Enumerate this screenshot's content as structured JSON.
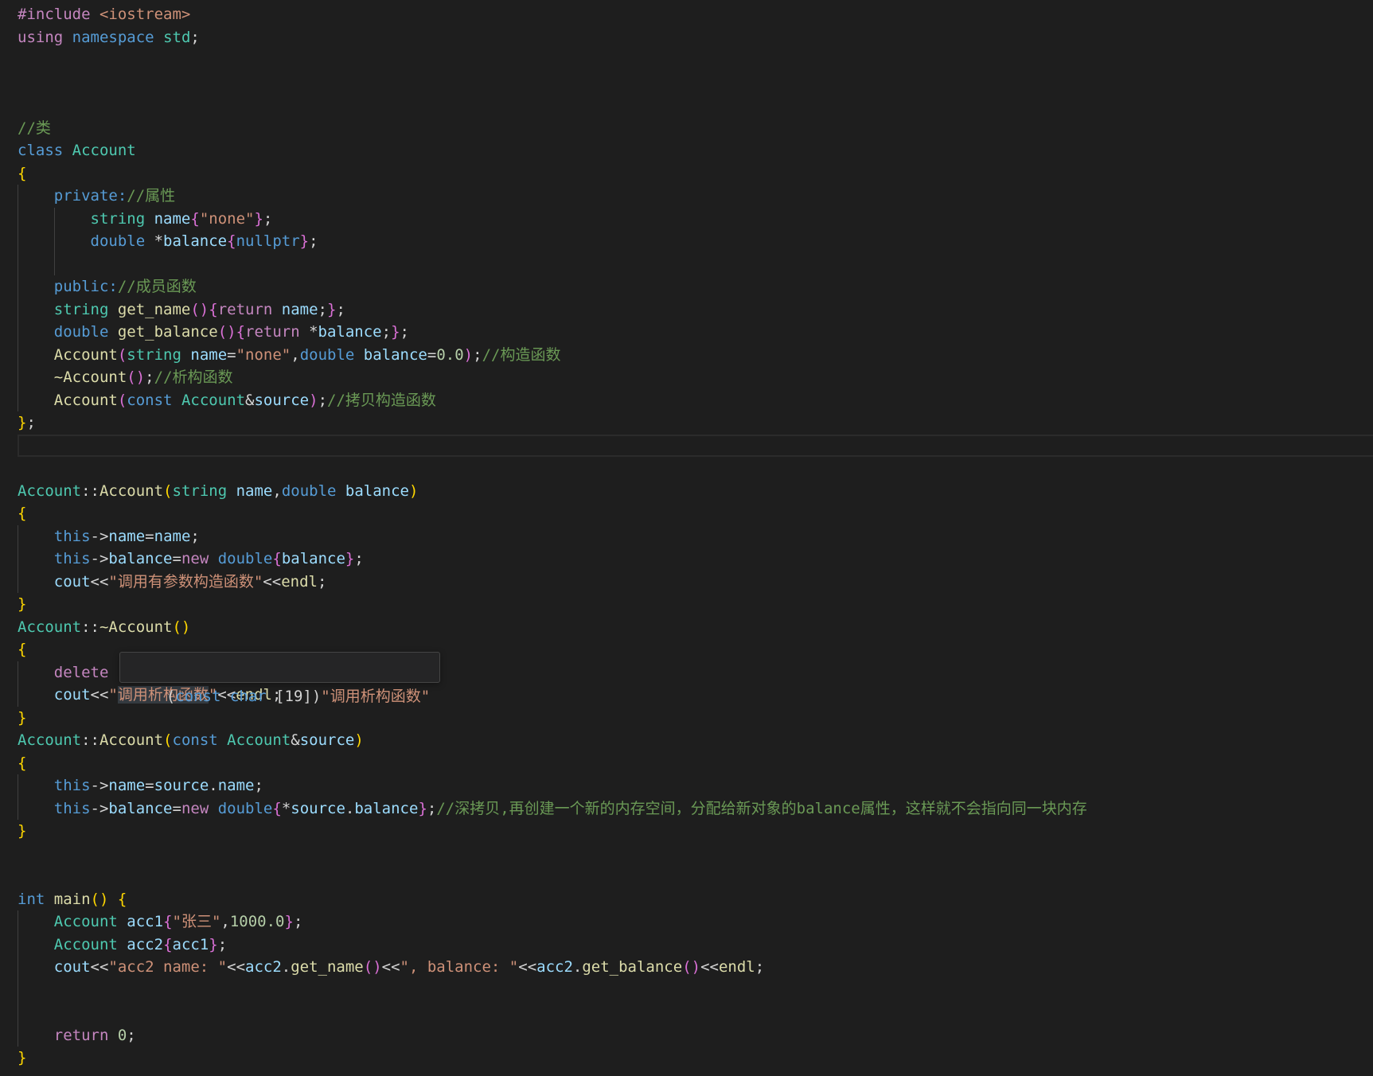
{
  "editor": {
    "lines": [
      [
        [
          "#include",
          "#c586c0"
        ],
        [
          " ",
          "#d4d4d4"
        ],
        [
          "<iostream>",
          "#ce9178"
        ]
      ],
      [
        [
          "using",
          "#c586c0"
        ],
        [
          " ",
          "#d4d4d4"
        ],
        [
          "namespace",
          "#569cd6"
        ],
        [
          " ",
          "#d4d4d4"
        ],
        [
          "std",
          "#4ec9b0"
        ],
        [
          ";",
          "#d4d4d4"
        ]
      ],
      [],
      [],
      [],
      [
        [
          "//类",
          "#6a9955"
        ]
      ],
      [
        [
          "class",
          "#569cd6"
        ],
        [
          " ",
          "#d4d4d4"
        ],
        [
          "Account",
          "#4ec9b0"
        ]
      ],
      [
        [
          "{",
          "#ffd700"
        ]
      ],
      [
        [
          "    private:",
          "#569cd6"
        ],
        [
          "//属性",
          "#6a9955"
        ]
      ],
      [
        [
          "        string",
          "#4ec9b0"
        ],
        [
          " ",
          "#d4d4d4"
        ],
        [
          "name",
          "#9cdcfe"
        ],
        [
          "{",
          "#da70d6"
        ],
        [
          "\"none\"",
          "#ce9178"
        ],
        [
          "}",
          "#da70d6"
        ],
        [
          ";",
          "#d4d4d4"
        ]
      ],
      [
        [
          "        double",
          "#569cd6"
        ],
        [
          " *",
          "#d4d4d4"
        ],
        [
          "balance",
          "#9cdcfe"
        ],
        [
          "{",
          "#da70d6"
        ],
        [
          "nullptr",
          "#569cd6"
        ],
        [
          "}",
          "#da70d6"
        ],
        [
          ";",
          "#d4d4d4"
        ]
      ],
      [],
      [
        [
          "    public:",
          "#569cd6"
        ],
        [
          "//成员函数",
          "#6a9955"
        ]
      ],
      [
        [
          "    string",
          "#4ec9b0"
        ],
        [
          " ",
          "#d4d4d4"
        ],
        [
          "get_name",
          "#dcdcaa"
        ],
        [
          "(){",
          "#da70d6"
        ],
        [
          "return",
          "#c586c0"
        ],
        [
          " ",
          "#d4d4d4"
        ],
        [
          "name",
          "#9cdcfe"
        ],
        [
          ";",
          "#d4d4d4"
        ],
        [
          "}",
          "#da70d6"
        ],
        [
          ";",
          "#d4d4d4"
        ]
      ],
      [
        [
          "    double",
          "#569cd6"
        ],
        [
          " ",
          "#d4d4d4"
        ],
        [
          "get_balance",
          "#dcdcaa"
        ],
        [
          "(){",
          "#da70d6"
        ],
        [
          "return",
          "#c586c0"
        ],
        [
          " *",
          "#d4d4d4"
        ],
        [
          "balance",
          "#9cdcfe"
        ],
        [
          ";",
          "#d4d4d4"
        ],
        [
          "}",
          "#da70d6"
        ],
        [
          ";",
          "#d4d4d4"
        ]
      ],
      [
        [
          "    Account",
          "#dcdcaa"
        ],
        [
          "(",
          "#da70d6"
        ],
        [
          "string",
          "#4ec9b0"
        ],
        [
          " ",
          "#d4d4d4"
        ],
        [
          "name",
          "#9cdcfe"
        ],
        [
          "=",
          "#d4d4d4"
        ],
        [
          "\"none\"",
          "#ce9178"
        ],
        [
          ",",
          "#d4d4d4"
        ],
        [
          "double",
          "#569cd6"
        ],
        [
          " ",
          "#d4d4d4"
        ],
        [
          "balance",
          "#9cdcfe"
        ],
        [
          "=",
          "#d4d4d4"
        ],
        [
          "0.0",
          "#b5cea8"
        ],
        [
          ")",
          "#da70d6"
        ],
        [
          ";",
          "#d4d4d4"
        ],
        [
          "//构造函数",
          "#6a9955"
        ]
      ],
      [
        [
          "    ~Account",
          "#dcdcaa"
        ],
        [
          "()",
          "#da70d6"
        ],
        [
          ";",
          "#d4d4d4"
        ],
        [
          "//析构函数",
          "#6a9955"
        ]
      ],
      [
        [
          "    Account",
          "#dcdcaa"
        ],
        [
          "(",
          "#da70d6"
        ],
        [
          "const",
          "#569cd6"
        ],
        [
          " ",
          "#d4d4d4"
        ],
        [
          "Account",
          "#4ec9b0"
        ],
        [
          "&",
          "#d4d4d4"
        ],
        [
          "source",
          "#9cdcfe"
        ],
        [
          ")",
          "#da70d6"
        ],
        [
          ";",
          "#d4d4d4"
        ],
        [
          "//拷贝构造函数",
          "#6a9955"
        ]
      ],
      [
        [
          "}",
          "#ffd700"
        ],
        [
          ";",
          "#d4d4d4"
        ]
      ],
      [],
      [],
      [
        [
          "Account",
          "#4ec9b0"
        ],
        [
          "::",
          "#d4d4d4"
        ],
        [
          "Account",
          "#dcdcaa"
        ],
        [
          "(",
          "#ffd700"
        ],
        [
          "string",
          "#4ec9b0"
        ],
        [
          " ",
          "#d4d4d4"
        ],
        [
          "name",
          "#9cdcfe"
        ],
        [
          ",",
          "#d4d4d4"
        ],
        [
          "double",
          "#569cd6"
        ],
        [
          " ",
          "#d4d4d4"
        ],
        [
          "balance",
          "#9cdcfe"
        ],
        [
          ")",
          "#ffd700"
        ]
      ],
      [
        [
          "{",
          "#ffd700"
        ]
      ],
      [
        [
          "    this",
          "#569cd6"
        ],
        [
          "->",
          "#d4d4d4"
        ],
        [
          "name",
          "#9cdcfe"
        ],
        [
          "=",
          "#d4d4d4"
        ],
        [
          "name",
          "#9cdcfe"
        ],
        [
          ";",
          "#d4d4d4"
        ]
      ],
      [
        [
          "    this",
          "#569cd6"
        ],
        [
          "->",
          "#d4d4d4"
        ],
        [
          "balance",
          "#9cdcfe"
        ],
        [
          "=",
          "#d4d4d4"
        ],
        [
          "new",
          "#c586c0"
        ],
        [
          " ",
          "#d4d4d4"
        ],
        [
          "double",
          "#569cd6"
        ],
        [
          "{",
          "#da70d6"
        ],
        [
          "balance",
          "#9cdcfe"
        ],
        [
          "}",
          "#da70d6"
        ],
        [
          ";",
          "#d4d4d4"
        ]
      ],
      [
        [
          "    cout",
          "#9cdcfe"
        ],
        [
          "<<",
          "#d4d4d4"
        ],
        [
          "\"调用有参数构造函数\"",
          "#ce9178"
        ],
        [
          "<<",
          "#d4d4d4"
        ],
        [
          "endl",
          "#dcdcaa"
        ],
        [
          ";",
          "#d4d4d4"
        ]
      ],
      [
        [
          "}",
          "#ffd700"
        ]
      ],
      [
        [
          "Account",
          "#4ec9b0"
        ],
        [
          "::",
          "#d4d4d4"
        ],
        [
          "~Account",
          "#dcdcaa"
        ],
        [
          "()",
          "#ffd700"
        ]
      ],
      [
        [
          "{",
          "#ffd700"
        ]
      ],
      [
        [
          "    delete",
          "#c586c0"
        ]
      ],
      [
        [
          "    cout",
          "#9cdcfe"
        ],
        [
          "<<",
          "#d4d4d4"
        ],
        [
          "\"",
          "#ce9178"
        ],
        [
          "调用析构函数",
          "#ce9178",
          "#343a40"
        ],
        [
          "\"",
          "#ce9178"
        ],
        [
          "<<",
          "#d4d4d4"
        ],
        [
          "endl",
          "#dcdcaa"
        ],
        [
          ";",
          "#d4d4d4"
        ]
      ],
      [
        [
          "}",
          "#ffd700"
        ]
      ],
      [
        [
          "Account",
          "#4ec9b0"
        ],
        [
          "::",
          "#d4d4d4"
        ],
        [
          "Account",
          "#dcdcaa"
        ],
        [
          "(",
          "#ffd700"
        ],
        [
          "const",
          "#569cd6"
        ],
        [
          " ",
          "#d4d4d4"
        ],
        [
          "Account",
          "#4ec9b0"
        ],
        [
          "&",
          "#d4d4d4"
        ],
        [
          "source",
          "#9cdcfe"
        ],
        [
          ")",
          "#ffd700"
        ]
      ],
      [
        [
          "{",
          "#ffd700"
        ]
      ],
      [
        [
          "    this",
          "#569cd6"
        ],
        [
          "->",
          "#d4d4d4"
        ],
        [
          "name",
          "#9cdcfe"
        ],
        [
          "=",
          "#d4d4d4"
        ],
        [
          "source",
          "#9cdcfe"
        ],
        [
          ".",
          "#d4d4d4"
        ],
        [
          "name",
          "#9cdcfe"
        ],
        [
          ";",
          "#d4d4d4"
        ]
      ],
      [
        [
          "    this",
          "#569cd6"
        ],
        [
          "->",
          "#d4d4d4"
        ],
        [
          "balance",
          "#9cdcfe"
        ],
        [
          "=",
          "#d4d4d4"
        ],
        [
          "new",
          "#c586c0"
        ],
        [
          " ",
          "#d4d4d4"
        ],
        [
          "double",
          "#569cd6"
        ],
        [
          "{",
          "#da70d6"
        ],
        [
          "*",
          "#d4d4d4"
        ],
        [
          "source",
          "#9cdcfe"
        ],
        [
          ".",
          "#d4d4d4"
        ],
        [
          "balance",
          "#9cdcfe"
        ],
        [
          "}",
          "#da70d6"
        ],
        [
          ";",
          "#d4d4d4"
        ],
        [
          "//深拷贝,再创建一个新的内存空间，分配给新对象的balance属性，这样就不会指向同一块内存",
          "#6a9955"
        ]
      ],
      [
        [
          "}",
          "#ffd700"
        ]
      ],
      [],
      [],
      [
        [
          "int",
          "#569cd6"
        ],
        [
          " ",
          "#d4d4d4"
        ],
        [
          "main",
          "#dcdcaa"
        ],
        [
          "()",
          "#ffd700"
        ],
        [
          " ",
          "#d4d4d4"
        ],
        [
          "{",
          "#ffd700"
        ]
      ],
      [
        [
          "    Account",
          "#4ec9b0"
        ],
        [
          " ",
          "#d4d4d4"
        ],
        [
          "acc1",
          "#9cdcfe"
        ],
        [
          "{",
          "#da70d6"
        ],
        [
          "\"张三\"",
          "#ce9178"
        ],
        [
          ",",
          "#d4d4d4"
        ],
        [
          "1000.0",
          "#b5cea8"
        ],
        [
          "}",
          "#da70d6"
        ],
        [
          ";",
          "#d4d4d4"
        ]
      ],
      [
        [
          "    Account",
          "#4ec9b0"
        ],
        [
          " ",
          "#d4d4d4"
        ],
        [
          "acc2",
          "#9cdcfe"
        ],
        [
          "{",
          "#da70d6"
        ],
        [
          "acc1",
          "#9cdcfe"
        ],
        [
          "}",
          "#da70d6"
        ],
        [
          ";",
          "#d4d4d4"
        ]
      ],
      [
        [
          "    cout",
          "#9cdcfe"
        ],
        [
          "<<",
          "#d4d4d4"
        ],
        [
          "\"acc2 name: \"",
          "#ce9178"
        ],
        [
          "<<",
          "#d4d4d4"
        ],
        [
          "acc2",
          "#9cdcfe"
        ],
        [
          ".",
          "#d4d4d4"
        ],
        [
          "get_name",
          "#dcdcaa"
        ],
        [
          "()",
          "#da70d6"
        ],
        [
          "<<",
          "#d4d4d4"
        ],
        [
          "\", balance: \"",
          "#ce9178"
        ],
        [
          "<<",
          "#d4d4d4"
        ],
        [
          "acc2",
          "#9cdcfe"
        ],
        [
          ".",
          "#d4d4d4"
        ],
        [
          "get_balance",
          "#dcdcaa"
        ],
        [
          "()",
          "#da70d6"
        ],
        [
          "<<",
          "#d4d4d4"
        ],
        [
          "endl",
          "#dcdcaa"
        ],
        [
          ";",
          "#d4d4d4"
        ]
      ],
      [],
      [],
      [
        [
          "    return",
          "#c586c0"
        ],
        [
          " ",
          "#d4d4d4"
        ],
        [
          "0",
          "#b5cea8"
        ],
        [
          ";",
          "#d4d4d4"
        ]
      ],
      [
        [
          "}",
          "#ffd700"
        ]
      ]
    ],
    "hover": [
      [
        "(",
        "#d4d4d4"
      ],
      [
        "const",
        "#569cd6"
      ],
      [
        " ",
        "#d4d4d4"
      ],
      [
        "char",
        "#569cd6"
      ],
      [
        " [19])",
        "#d4d4d4"
      ],
      [
        "\"调用析构函数\"",
        "#ce9178"
      ]
    ]
  },
  "colors": {
    "background": "#1e1e1e",
    "indent_guide": "#404040",
    "hover_background": "#252526",
    "hover_border": "#454545"
  }
}
